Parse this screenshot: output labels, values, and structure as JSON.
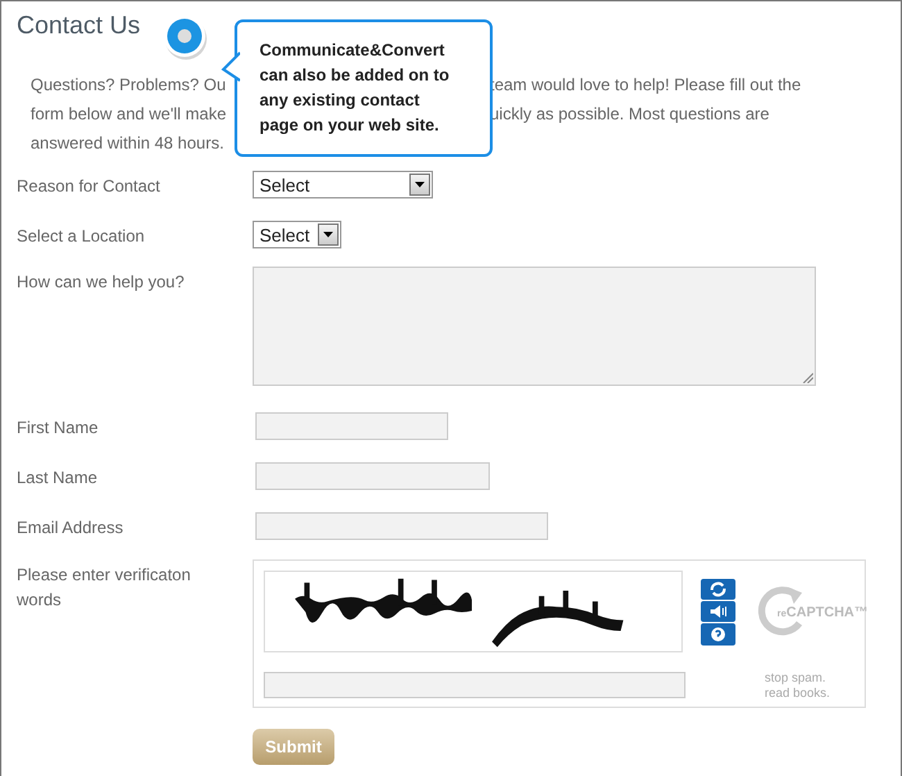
{
  "title": "Contact Us",
  "intro": {
    "left_lines": [
      "Questions? Problems? Ou",
      "form below and we'll make",
      "answered within 48 hours."
    ],
    "right_lines": [
      "team would love to help! Please fill out the",
      "uickly as possible. Most questions are"
    ]
  },
  "callout": {
    "text": "Communicate&Convert can also be added on to any existing contact page on your web site."
  },
  "fields": [
    {
      "kind": "select",
      "label": "Reason for Contact",
      "value": "Select"
    },
    {
      "kind": "select",
      "label": "Select a Location",
      "value": "Select"
    },
    {
      "kind": "textarea",
      "label": "How can we help you?"
    },
    {
      "kind": "text",
      "label": "First Name"
    },
    {
      "kind": "text",
      "label": "Last Name"
    },
    {
      "kind": "text",
      "label": "Email Address"
    },
    {
      "kind": "captcha",
      "label": "Please enter verificaton words",
      "logo_prefix": "re",
      "logo_text": "CAPTCHA™",
      "caption": "stop spam.\nread books."
    }
  ],
  "submit": "Submit"
}
